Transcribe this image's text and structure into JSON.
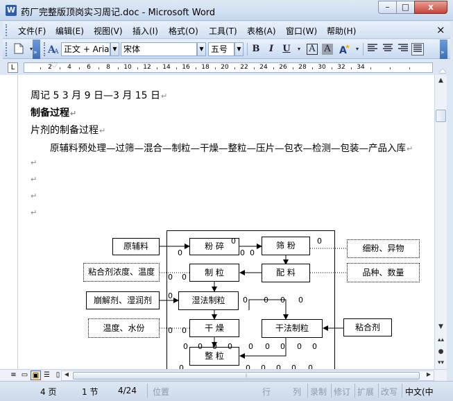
{
  "window": {
    "icon": "W",
    "title": "药厂完整版顶岗实习周记.doc - Microsoft Word",
    "minimize": "–",
    "maximize": "□",
    "close": "x"
  },
  "menu": {
    "items": [
      "文件(F)",
      "编辑(E)",
      "视图(V)",
      "插入(I)",
      "格式(O)",
      "工具(T)",
      "表格(A)",
      "窗口(W)",
      "帮助(H)"
    ],
    "close": "×"
  },
  "toolbar": {
    "style_value": "正文 + Aria",
    "font_value": "宋体",
    "size_value": "五号",
    "bold": "B",
    "italic": "I",
    "underline": "U",
    "char_border": "A",
    "char_shading": "A"
  },
  "ruler": {
    "corner": "L",
    "numbers": [
      "2",
      "4",
      "6",
      "8",
      "10",
      "12",
      "14",
      "16",
      "18",
      "20",
      "22",
      "24",
      "26",
      "28",
      "30",
      "32",
      "34"
    ]
  },
  "document": {
    "line1": "周记 5     3 月 9 日—3 月 15 日",
    "line2": "制备过程",
    "line3": "片剂的制备过程",
    "line4": "原辅料预处理—过筛—混合—制粒—干燥—整粒—压片—包衣—检测—包装—产品入库",
    "para_mark": "↵"
  },
  "flowchart": {
    "boxes": {
      "raw": "原辅料",
      "crush": "粉 碎",
      "sieve": "筛 粉",
      "fine": "细粉、异物",
      "binder_conc": "粘合剂浓度、温度",
      "granulate": "制 粒",
      "mix": "配 料",
      "variety": "品种、数量",
      "disint": "崩解剂、湿润剂",
      "wet": "湿法制粒",
      "temp": "温度、水份",
      "dry": "干 燥",
      "drygran": "干法制粒",
      "binder": "粘合剂",
      "whole": "整 粒"
    },
    "zero": "0"
  },
  "status": {
    "page": "4 页",
    "section": "1 节",
    "pages": "4/24",
    "position": "位置",
    "line": "行",
    "col": "列",
    "rec": "录制",
    "trk": "修订",
    "ext": "扩展",
    "ovr": "改写",
    "lang": "中文(中"
  }
}
